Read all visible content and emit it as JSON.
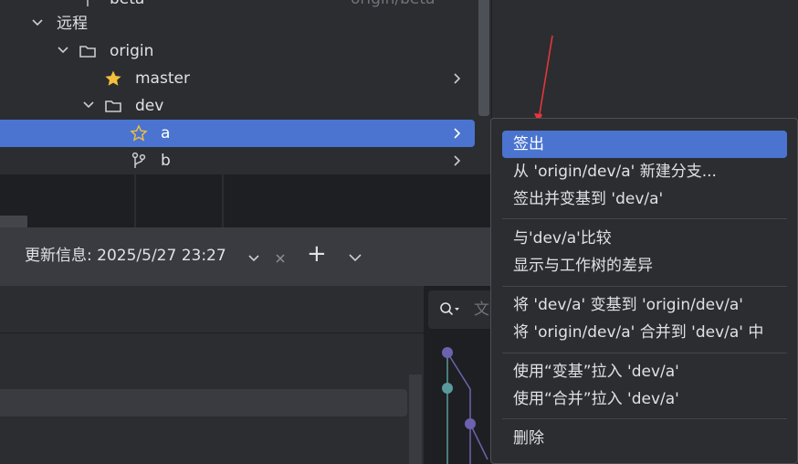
{
  "tree": {
    "items": [
      {
        "label": "beta",
        "extra": "origin/beta"
      },
      {
        "label": "远程"
      },
      {
        "label": "origin"
      },
      {
        "label": "master"
      },
      {
        "label": "dev"
      },
      {
        "label": "a"
      },
      {
        "label": "b"
      }
    ]
  },
  "update_bar": {
    "text": "更新信息: 2025/5/27 23:27",
    "add_label": "+"
  },
  "search": {
    "placeholder_char": "文"
  },
  "context_menu": {
    "items": [
      {
        "label": "签出",
        "highlighted": true
      },
      {
        "label": "从 'origin/dev/a' 新建分支..."
      },
      {
        "label": "签出并变基到 'dev/a'"
      },
      {
        "label": "与'dev/a'比较"
      },
      {
        "label": "显示与工作树的差异"
      },
      {
        "label": "将 'dev/a' 变基到 'origin/dev/a'"
      },
      {
        "label": "将 'origin/dev/a' 合并到 'dev/a' 中"
      },
      {
        "label": "使用“变基”拉入 'dev/a'"
      },
      {
        "label": "使用“合并”拉入 'dev/a'"
      },
      {
        "label": "删除"
      }
    ]
  },
  "colors": {
    "accent": "#4a74cf",
    "star": "#f2c03c",
    "annotation_arrow": "#e5363a",
    "graph_purple": "#6b63b0",
    "graph_teal": "#5a9a9c"
  }
}
